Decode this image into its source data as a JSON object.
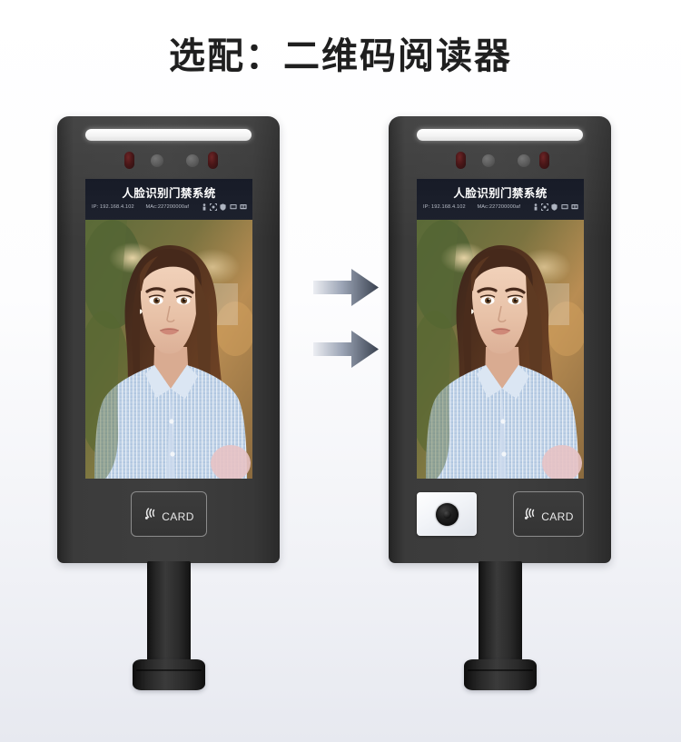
{
  "page": {
    "title": "选配：二维码阅读器"
  },
  "colors": {
    "background_top": "#ffffff",
    "background_bottom": "#e7e9f0",
    "title_text": "#1f1f1f",
    "device_body": "#3e3e3e",
    "screen_header": "#1b1f2b",
    "led_bar": "#ffffff",
    "ir_sensor": "#4a1718",
    "camera_sensor": "#5c5c5c",
    "qr_module": "#ffffff",
    "qr_lens": "#1e1e1e",
    "card_badge_border": "#8c8c8c",
    "arrow_dark": "#3f4756",
    "arrow_light": "#e6e8ee"
  },
  "devices": [
    {
      "id": "device-left",
      "name": "face-recognition-terminal-standard",
      "screen": {
        "title": "人脸识别门禁系统",
        "ip_label": "IP:",
        "ip_value": "192.168.4.102",
        "mac_label": "MAc:",
        "mac_value": "227200000af",
        "status_icons": [
          "person-icon",
          "face-scan-icon",
          "shield-icon",
          "network-icon",
          "storage-icon"
        ]
      },
      "top_bar": {
        "led_light": "led-light-bar",
        "sensors": [
          "ir-sensor-left",
          "camera-sensor-left",
          "camera-sensor-right",
          "ir-sensor-right"
        ]
      },
      "modules": {
        "has_qr_reader": false,
        "card_reader_label": "CARD"
      },
      "stand": {
        "pole": "stand-pole",
        "base": "stand-base"
      }
    },
    {
      "id": "device-right",
      "name": "face-recognition-terminal-with-qr",
      "screen": {
        "title": "人脸识别门禁系统",
        "ip_label": "IP:",
        "ip_value": "192.168.4.102",
        "mac_label": "MAc:",
        "mac_value": "227200000af",
        "status_icons": [
          "person-icon",
          "face-scan-icon",
          "shield-icon",
          "network-icon",
          "storage-icon"
        ]
      },
      "top_bar": {
        "led_light": "led-light-bar",
        "sensors": [
          "ir-sensor-left",
          "camera-sensor-left",
          "camera-sensor-right",
          "ir-sensor-right"
        ]
      },
      "modules": {
        "has_qr_reader": true,
        "qr_reader_name": "qr-code-reader-module",
        "card_reader_label": "CARD"
      },
      "stand": {
        "pole": "stand-pole",
        "base": "stand-base"
      }
    }
  ],
  "arrows": {
    "count": 2,
    "direction": "right",
    "name": "upgrade-arrow"
  }
}
